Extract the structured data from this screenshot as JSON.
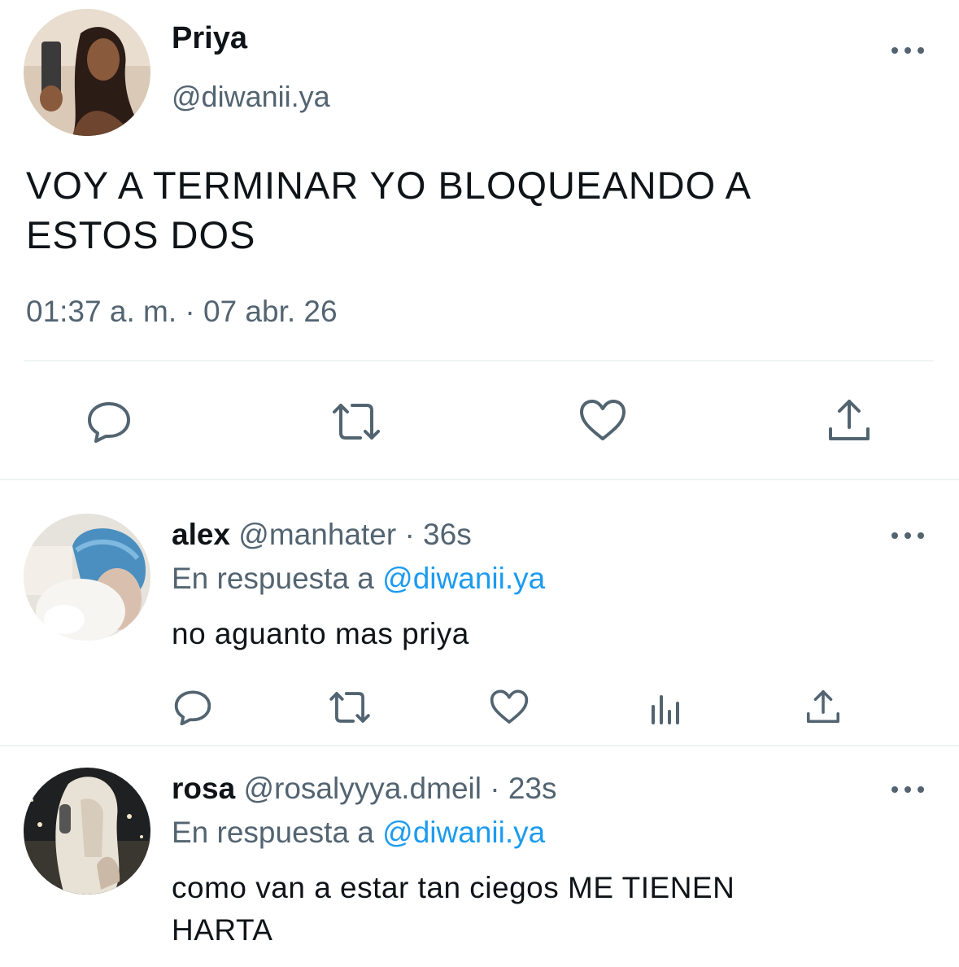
{
  "main_tweet": {
    "display_name": "Priya",
    "handle": "@diwanii.ya",
    "text_line1": "VOY A TERMINAR YO BLOQUEANDO A",
    "text_line2": "ESTOS DOS",
    "timestamp": "01:37 a. m. · 07 abr. 26",
    "actions": [
      "reply-icon",
      "retweet-icon",
      "like-icon",
      "share-icon"
    ]
  },
  "replies": [
    {
      "display_name": "alex",
      "handle": "@manhater",
      "time": "· 36s",
      "replying_label": "En respuesta a",
      "replying_to": "@diwanii.ya",
      "text_line1": "no aguanto mas priya",
      "text_line2": "",
      "actions": [
        "reply-icon",
        "retweet-icon",
        "like-icon",
        "views-icon",
        "share-icon"
      ]
    },
    {
      "display_name": "rosa",
      "handle": "@rosalyyya.dmeil",
      "time": "· 23s",
      "replying_label": "En respuesta a",
      "replying_to": "@diwanii.ya",
      "text_line1": "como van a estar tan ciegos ME TIENEN",
      "text_line2": "HARTA"
    }
  ],
  "colors": {
    "accent": "#1d9bf0",
    "muted": "#536471",
    "text": "#0f1419",
    "divider": "#eff3f4"
  }
}
